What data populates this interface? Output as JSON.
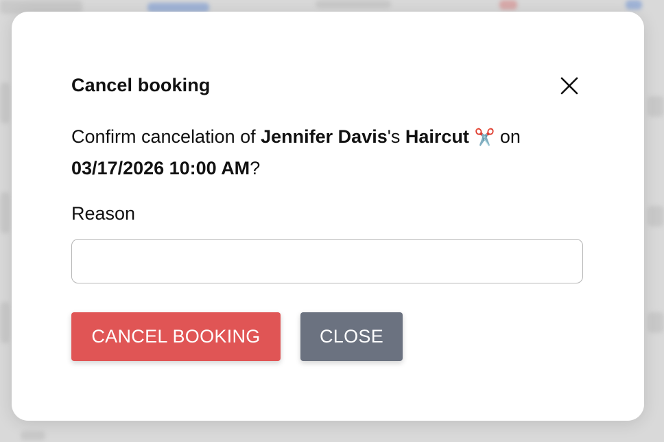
{
  "modal": {
    "title": "Cancel booking",
    "message": {
      "prefix": "Confirm cancelation of ",
      "client_name": "Jennifer Davis",
      "possessive": "'s ",
      "service": "Haircut",
      "service_icon": "✂️",
      "on_text": " on",
      "datetime": "03/17/2026 10:00 AM",
      "suffix": "?"
    },
    "reason_label": "Reason",
    "reason_value": "",
    "cancel_button_label": "CANCEL BOOKING",
    "close_button_label": "CLOSE"
  },
  "colors": {
    "danger": "#e05555",
    "secondary": "#6b7280"
  },
  "icons": {
    "close": "close-icon",
    "service": "scissors-icon"
  }
}
